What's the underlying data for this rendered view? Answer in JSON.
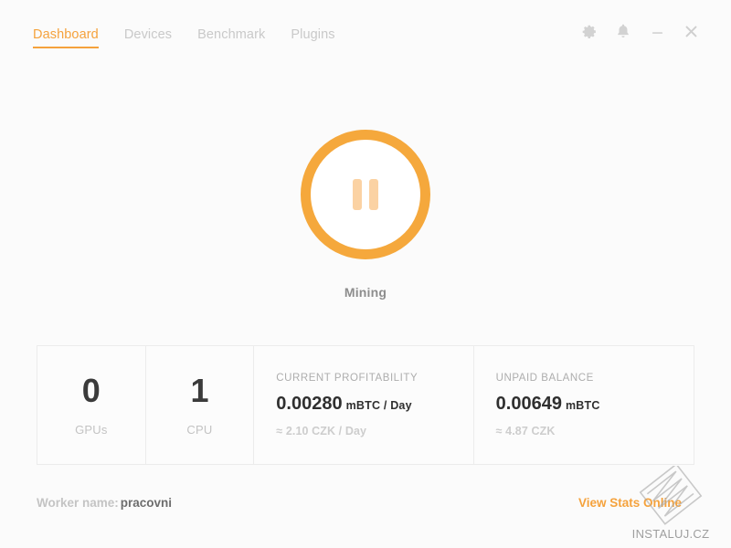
{
  "app": {
    "background_color": "#fbfbfb",
    "accent_color": "#f5a23c"
  },
  "nav": {
    "items": [
      {
        "label": "Dashboard",
        "active": true
      },
      {
        "label": "Devices",
        "active": false
      },
      {
        "label": "Benchmark",
        "active": false
      },
      {
        "label": "Plugins",
        "active": false
      }
    ]
  },
  "window_controls": [
    {
      "icon": "gear-icon",
      "name": "settings"
    },
    {
      "icon": "bell-icon",
      "name": "notifications"
    },
    {
      "icon": "minimize-icon",
      "name": "minimize"
    },
    {
      "icon": "close-icon",
      "name": "close"
    }
  ],
  "mining": {
    "state_label": "Mining",
    "button_icon": "pause-icon",
    "ring_color": "#f5a83c",
    "icon_color": "#fbd2a3"
  },
  "stats": {
    "gpus": {
      "value": "0",
      "label": "GPUs"
    },
    "cpu": {
      "value": "1",
      "label": "CPU"
    },
    "profitability": {
      "title": "CURRENT PROFITABILITY",
      "value": "0.00280",
      "unit": "mBTC / Day",
      "approx": "≈ 2.10 CZK / Day"
    },
    "balance": {
      "title": "UNPAID BALANCE",
      "value": "0.00649",
      "unit": "mBTC",
      "approx": "≈ 4.87 CZK"
    }
  },
  "footer": {
    "worker_label": "Worker name:",
    "worker_value": "pracovni",
    "stats_link": "View Stats Online"
  },
  "watermark": {
    "text": "INSTALUJ.CZ"
  }
}
